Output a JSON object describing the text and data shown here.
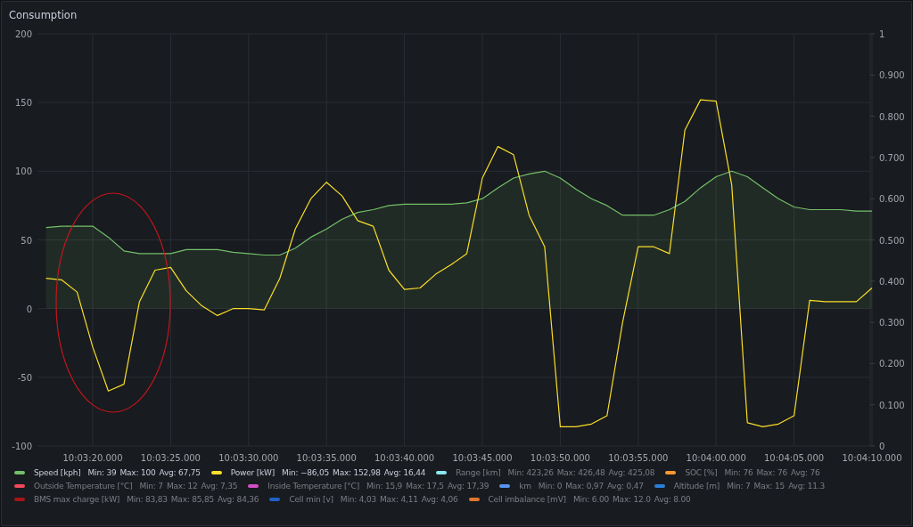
{
  "panel": {
    "title": "Consumption",
    "chart_data": {
      "type": "line",
      "categories": [
        null,
        null,
        null,
        "10:03:20.000",
        null,
        null,
        null,
        null,
        "10:03:25.000",
        null,
        null,
        null,
        null,
        "10:03:30.000",
        null,
        null,
        null,
        null,
        "10:03:35.000",
        null,
        null,
        null,
        null,
        "10:03:40.000",
        null,
        null,
        null,
        null,
        "10:03:45.000",
        null,
        null,
        null,
        null,
        "10:03:50.000",
        null,
        null,
        null,
        null,
        "10:03:55.000",
        null,
        null,
        null,
        null,
        "10:04:00.000",
        null,
        null,
        null,
        null,
        "10:04:05.000",
        null,
        null,
        null,
        null,
        "10:04:10.000"
      ],
      "ylim": [
        -100,
        200
      ],
      "grid": true,
      "yticks": [
        -100,
        -50,
        0,
        50,
        100,
        150,
        200
      ],
      "y2lim": [
        0,
        1
      ],
      "y2ticks": [
        {
          "value": 0,
          "label": "0"
        },
        {
          "value": 0.1,
          "label": "0.100"
        },
        {
          "value": 0.2,
          "label": "0.200"
        },
        {
          "value": 0.3,
          "label": "0.300"
        },
        {
          "value": 0.4,
          "label": "0.400"
        },
        {
          "value": 0.5,
          "label": "0.500"
        },
        {
          "value": 0.6,
          "label": "0.600"
        },
        {
          "value": 0.7,
          "label": "0.700"
        },
        {
          "value": 0.8,
          "label": "0.800"
        },
        {
          "value": 0.9,
          "label": "0.900"
        },
        {
          "value": 1,
          "label": "1"
        }
      ],
      "series": [
        {
          "color": "#73bf69",
          "values": [
            59,
            60,
            60,
            60,
            52,
            42,
            40,
            40,
            40,
            43,
            43,
            43,
            41,
            40,
            39,
            39,
            44,
            52,
            58,
            65,
            70,
            72,
            75,
            76,
            76,
            76,
            76,
            77,
            80,
            88,
            95,
            98,
            100,
            95,
            87,
            80,
            75,
            68,
            68,
            68,
            72,
            78,
            88,
            96,
            100,
            96,
            88,
            80,
            74,
            72,
            72,
            72,
            71,
            71
          ]
        },
        {
          "color": "#fade2a",
          "values": [
            22,
            21,
            12,
            -28,
            -60,
            -55,
            5,
            28,
            30,
            13,
            2,
            -5,
            0,
            0,
            -1,
            22,
            58,
            80,
            92,
            82,
            64,
            60,
            28,
            14,
            15,
            25,
            32,
            40,
            95,
            118,
            112,
            68,
            45,
            -86,
            -86,
            -84,
            -78,
            -10,
            45,
            45,
            40,
            130,
            152,
            151,
            90,
            -83,
            -86,
            -84,
            -78,
            6,
            5,
            5,
            5,
            15
          ]
        }
      ]
    },
    "highlight": {
      "kind": "ellipse",
      "color": "#c4161c"
    },
    "legend": [
      {
        "label": "Speed [kph]",
        "color": "#73bf69",
        "hidden": false,
        "stats": [
          "Min: 39",
          "Max: 100",
          "Avg: 67,75"
        ]
      },
      {
        "label": "Power [kW]",
        "color": "#fade2a",
        "hidden": false,
        "stats": [
          "Min: −86,05",
          "Max: 152,98",
          "Avg: 16,44"
        ]
      },
      {
        "label": "Range [km]",
        "color": "#8ae6f0",
        "hidden": true,
        "stats": [
          "Min: 423,26",
          "Max: 426,48",
          "Avg: 425,08"
        ]
      },
      {
        "label": "SOC [%]",
        "color": "#ff9830",
        "hidden": true,
        "stats": [
          "Min: 76",
          "Max: 76",
          "Avg: 76"
        ]
      },
      {
        "label": "Outside Temperature [°C]",
        "color": "#f2495c",
        "hidden": true,
        "stats": [
          "Min: 7",
          "Max: 12",
          "Avg: 7,35"
        ]
      },
      {
        "label": "Inside Temperature [°C]",
        "color": "#d44fc4",
        "hidden": true,
        "stats": [
          "Min: 15,9",
          "Max: 17,5",
          "Avg: 17,39"
        ]
      },
      {
        "label": "km",
        "color": "#5794f2",
        "hidden": true,
        "stats": [
          "Min: 0",
          "Max: 0,97",
          "Avg: 0,47"
        ]
      },
      {
        "label": "Altitude [m]",
        "color": "#2a7fd9",
        "hidden": true,
        "stats": [
          "Min: 7",
          "Max: 15",
          "Avg: 11.3"
        ]
      },
      {
        "label": "BMS max charge [kW]",
        "color": "#a3161a",
        "hidden": true,
        "stats": [
          "Min: 83,83",
          "Max: 85,85",
          "Avg: 84,36"
        ]
      },
      {
        "label": "Cell min [v]",
        "color": "#1f60c4",
        "hidden": true,
        "stats": [
          "Min: 4,03",
          "Max: 4,11",
          "Avg: 4,06"
        ]
      },
      {
        "label": "Cell imbalance [mV]",
        "color": "#e0752d",
        "hidden": true,
        "stats": [
          "Min: 6.00",
          "Max: 12.0",
          "Avg: 8.00"
        ]
      }
    ]
  }
}
